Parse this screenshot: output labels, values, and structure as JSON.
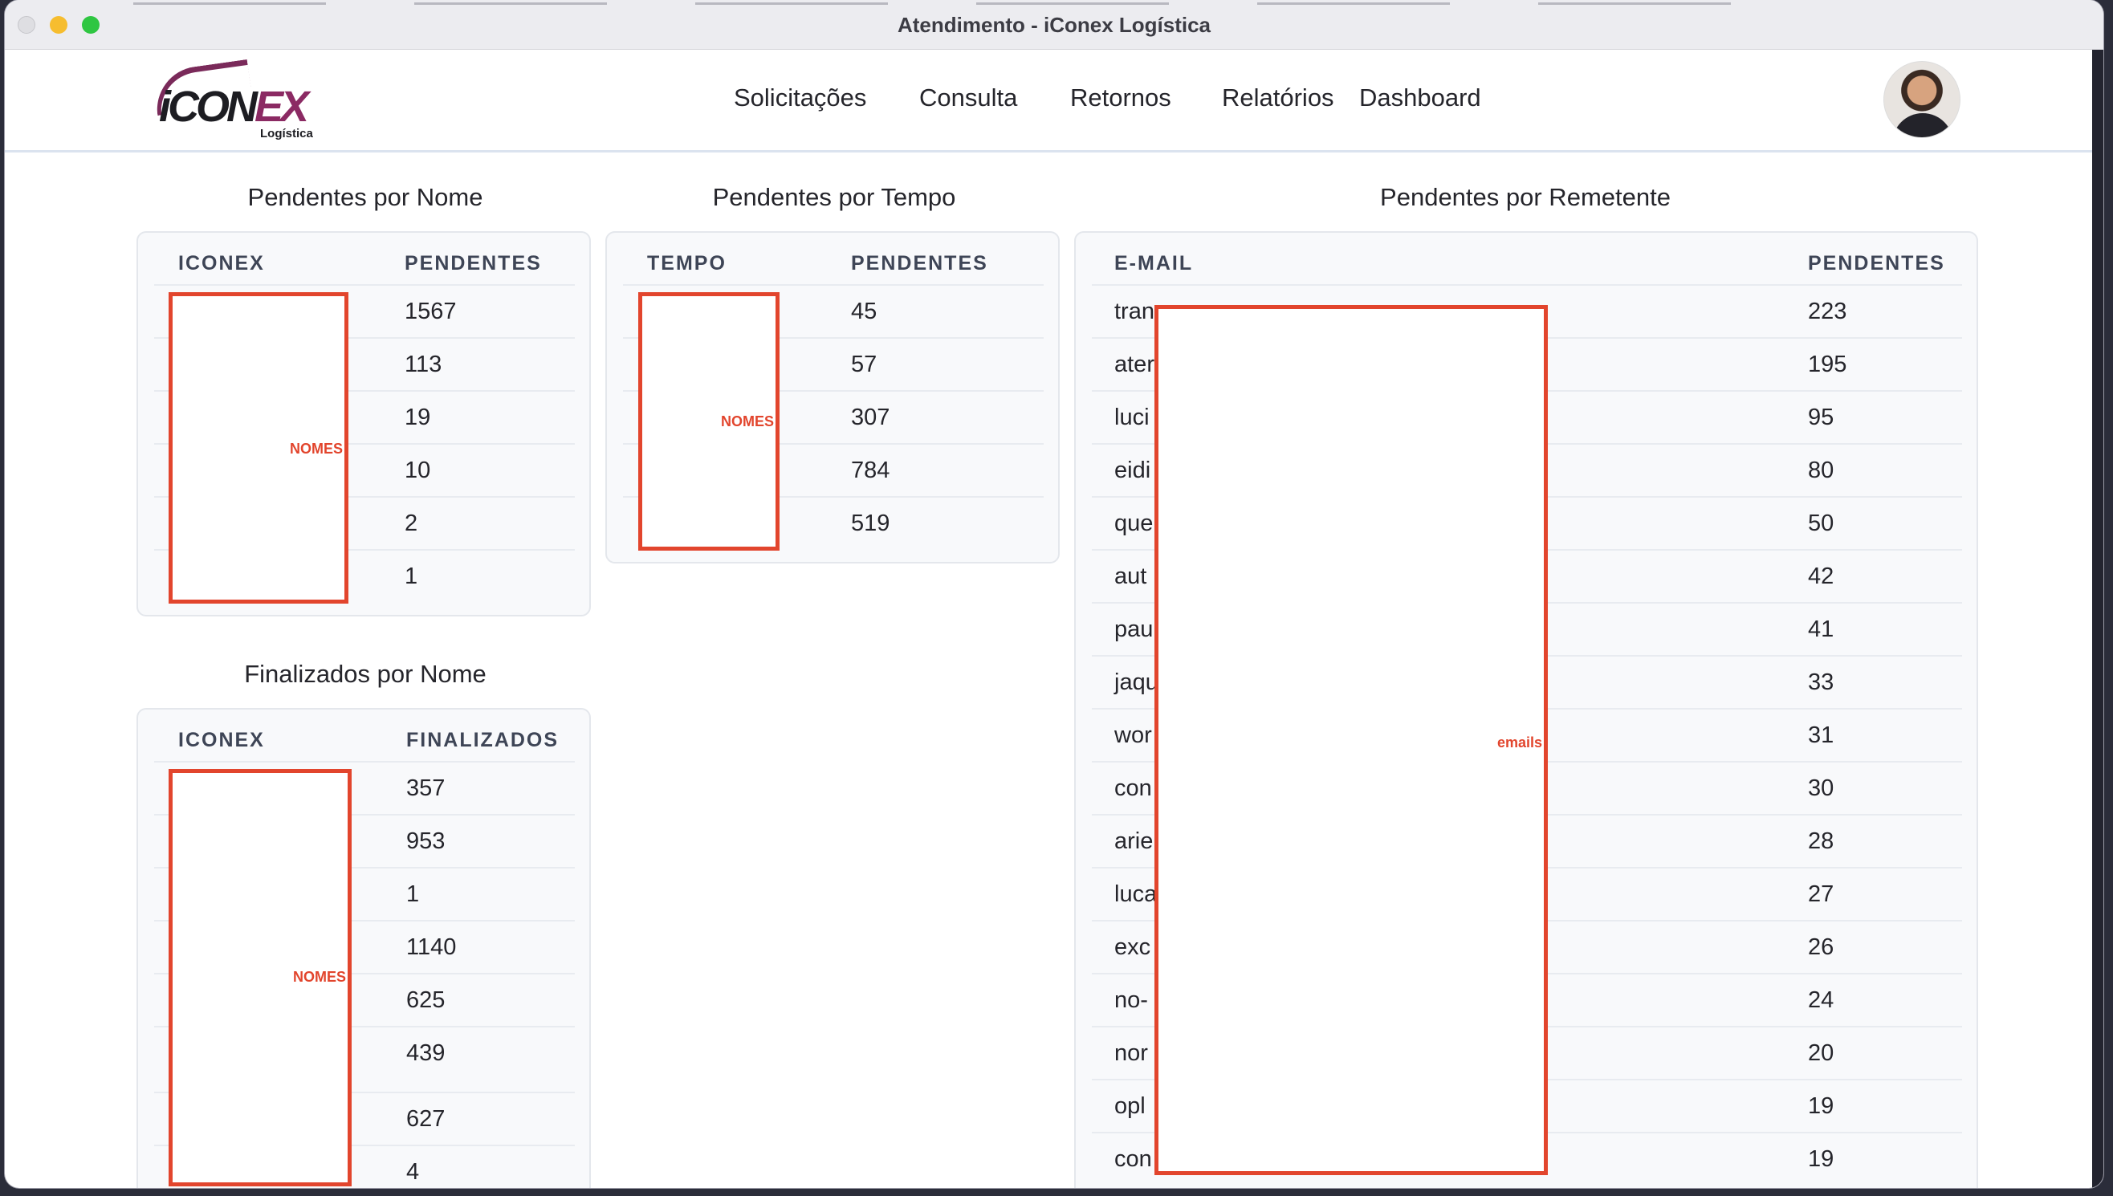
{
  "window": {
    "title": "Atendimento - iConex Logística"
  },
  "logo": {
    "text": "iCONEX",
    "text_main": "iCON",
    "text_accent": "EX",
    "sub": "Logística",
    "brand_color": "#8b2a63"
  },
  "nav": {
    "links": [
      "Solicitações",
      "Consulta",
      "Retornos",
      "Relatórios",
      "Dashboard"
    ]
  },
  "colors": {
    "accent_red": "#e2452d",
    "card_bg": "#f8f9fb"
  },
  "pendentes_nome": {
    "title": "Pendentes por Nome",
    "headers": [
      "ICONEX",
      "PENDENTES"
    ],
    "values": [
      "1567",
      "113",
      "19",
      "10",
      "2",
      "1"
    ],
    "redaction_label": "NOMES"
  },
  "pendentes_tempo": {
    "title": "Pendentes por Tempo",
    "headers": [
      "TEMPO",
      "PENDENTES"
    ],
    "values": [
      "45",
      "57",
      "307",
      "784",
      "519"
    ],
    "redaction_label": "NOMES"
  },
  "pendentes_remetente": {
    "title": "Pendentes por Remetente",
    "headers": [
      "E-MAIL",
      "PENDENTES"
    ],
    "emails": [
      "tran",
      "ater",
      "luci",
      "eidi",
      "que",
      "aut",
      "pau",
      "jaqu",
      "wor",
      "con",
      "arie",
      "luca",
      "exc",
      "no-",
      "nor",
      "opl",
      "con"
    ],
    "values": [
      "223",
      "195",
      "95",
      "80",
      "50",
      "42",
      "41",
      "33",
      "31",
      "30",
      "28",
      "27",
      "26",
      "24",
      "20",
      "19",
      "19"
    ],
    "redaction_label": "emails"
  },
  "finalizados_nome": {
    "title": "Finalizados por Nome",
    "headers": [
      "ICONEX",
      "FINALIZADOS"
    ],
    "values": [
      "357",
      "953",
      "1",
      "1140",
      "625",
      "439",
      "627",
      "4"
    ],
    "redaction_label": "NOMES"
  }
}
